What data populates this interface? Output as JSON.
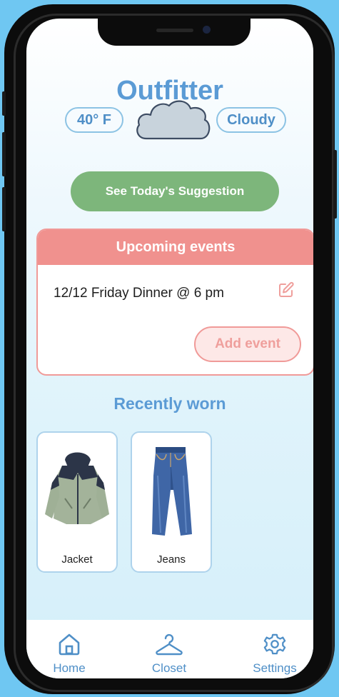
{
  "app": {
    "title": "Outfitter"
  },
  "weather": {
    "temperature": "40° F",
    "condition": "Cloudy",
    "icon": "cloud-icon"
  },
  "suggestion_button": {
    "label": "See Today's Suggestion"
  },
  "events": {
    "header": "Upcoming events",
    "items": [
      {
        "text": "12/12 Friday Dinner @ 6 pm",
        "icon": "edit-icon"
      }
    ],
    "add_label": "Add event"
  },
  "recently_worn": {
    "title": "Recently worn",
    "items": [
      {
        "label": "Jacket",
        "icon": "jacket-image"
      },
      {
        "label": "Jeans",
        "icon": "jeans-image"
      }
    ]
  },
  "tabbar": {
    "items": [
      {
        "label": "Home",
        "icon": "home-icon"
      },
      {
        "label": "Closet",
        "icon": "hanger-icon"
      },
      {
        "label": "Settings",
        "icon": "gear-icon"
      }
    ]
  },
  "colors": {
    "accent_blue": "#5b9bd5",
    "green_button": "#7db67b",
    "event_pink": "#f0918e",
    "background_sky": "#6fc7f2"
  }
}
